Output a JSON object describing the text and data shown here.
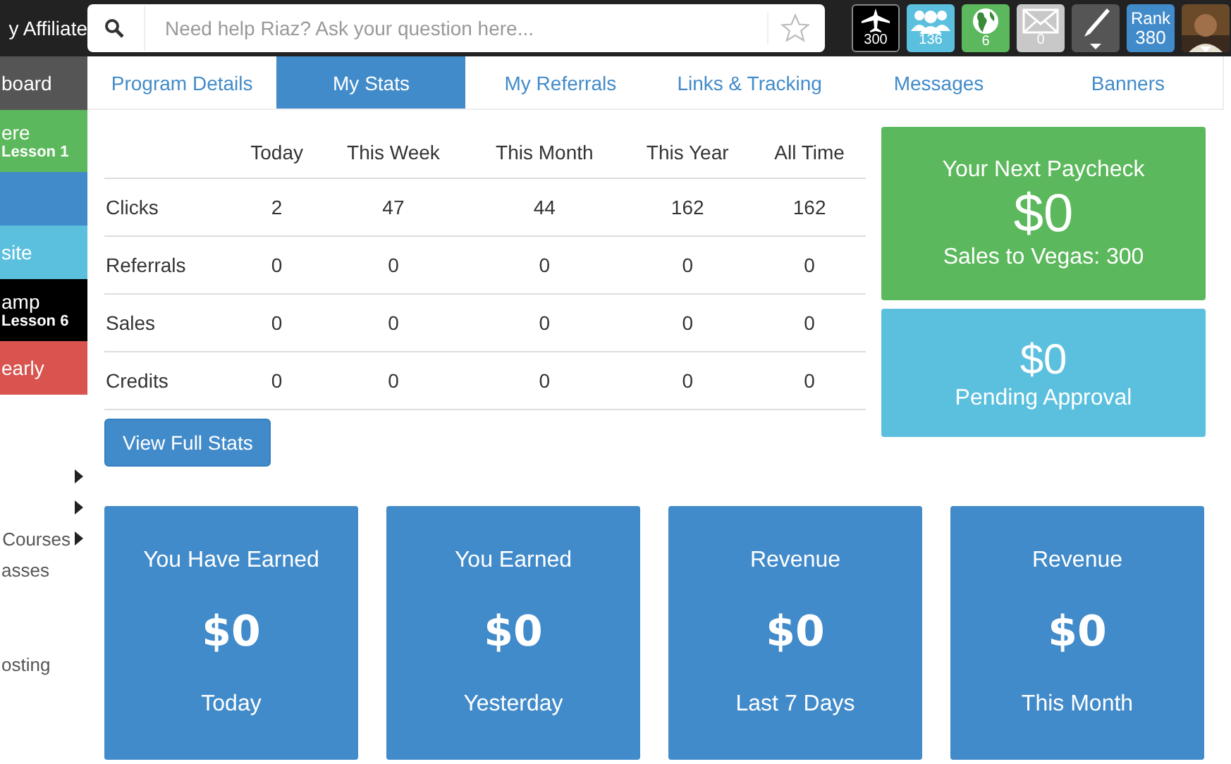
{
  "brand": "y Affiliate",
  "search": {
    "placeholder": "Need help Riaz? Ask your question here..."
  },
  "top_icons": [
    {
      "kind": "plane",
      "count": "300",
      "color": "#000000"
    },
    {
      "kind": "people",
      "count": "136",
      "color": "#5bc0de"
    },
    {
      "kind": "globe",
      "count": "6",
      "color": "#5cb85c"
    },
    {
      "kind": "mail",
      "count": "0",
      "color": "#c8c8c8"
    },
    {
      "kind": "pen",
      "color": "#555555"
    },
    {
      "kind": "rank",
      "label": "Rank",
      "count": "380",
      "color": "#428bca"
    },
    {
      "kind": "avatar"
    }
  ],
  "sidebar": {
    "items": [
      {
        "lines": [
          "board"
        ],
        "color": "#555555"
      },
      {
        "lines": [
          "ere",
          "Lesson 1"
        ],
        "color": "#5cb85c"
      },
      {
        "color": "#428bca"
      },
      {
        "lines": [
          "site"
        ],
        "color": "#5bc0de"
      },
      {
        "lines": [
          "amp",
          "Lesson 6"
        ],
        "color": "#000000"
      },
      {
        "lines": [
          "early"
        ],
        "color": "#d9534f"
      }
    ],
    "menu": [
      {
        "submenu": true
      },
      {
        "submenu": true
      },
      {
        "label": "Courses",
        "submenu": true
      },
      {
        "label": "asses",
        "submenu": false
      },
      {
        "label": "osting",
        "submenu": false
      }
    ]
  },
  "tabs": [
    {
      "label": "Program Details",
      "selected": false
    },
    {
      "label": "My Stats",
      "selected": true
    },
    {
      "label": "My Referrals",
      "selected": false
    },
    {
      "label": "Links & Tracking",
      "selected": false
    },
    {
      "label": "Messages",
      "selected": false
    },
    {
      "label": "Banners",
      "selected": false
    }
  ],
  "table": {
    "columns": [
      "Today",
      "This Week",
      "This Month",
      "This Year",
      "All Time"
    ],
    "rows": [
      {
        "label": "Clicks",
        "cells": [
          "2",
          "47",
          "44",
          "162",
          "162"
        ]
      },
      {
        "label": "Referrals",
        "cells": [
          "0",
          "0",
          "0",
          "0",
          "0"
        ]
      },
      {
        "label": "Sales",
        "cells": [
          "0",
          "0",
          "0",
          "0",
          "0"
        ]
      },
      {
        "label": "Credits",
        "cells": [
          "0",
          "0",
          "0",
          "0",
          "0"
        ]
      }
    ]
  },
  "view_button": "View Full Stats",
  "paycheck": {
    "title": "Your Next Paycheck",
    "amount": "$0",
    "note": "Sales to Vegas: 300"
  },
  "pending": {
    "amount": "$0",
    "label": "Pending Approval"
  },
  "earnings": [
    {
      "title": "You Have Earned",
      "amount": "$0",
      "period": "Today"
    },
    {
      "title": "You Earned",
      "amount": "$0",
      "period": "Yesterday"
    },
    {
      "title": "Revenue",
      "amount": "$0",
      "period": "Last 7 Days"
    },
    {
      "title": "Revenue",
      "amount": "$0",
      "period": "This Month"
    }
  ]
}
